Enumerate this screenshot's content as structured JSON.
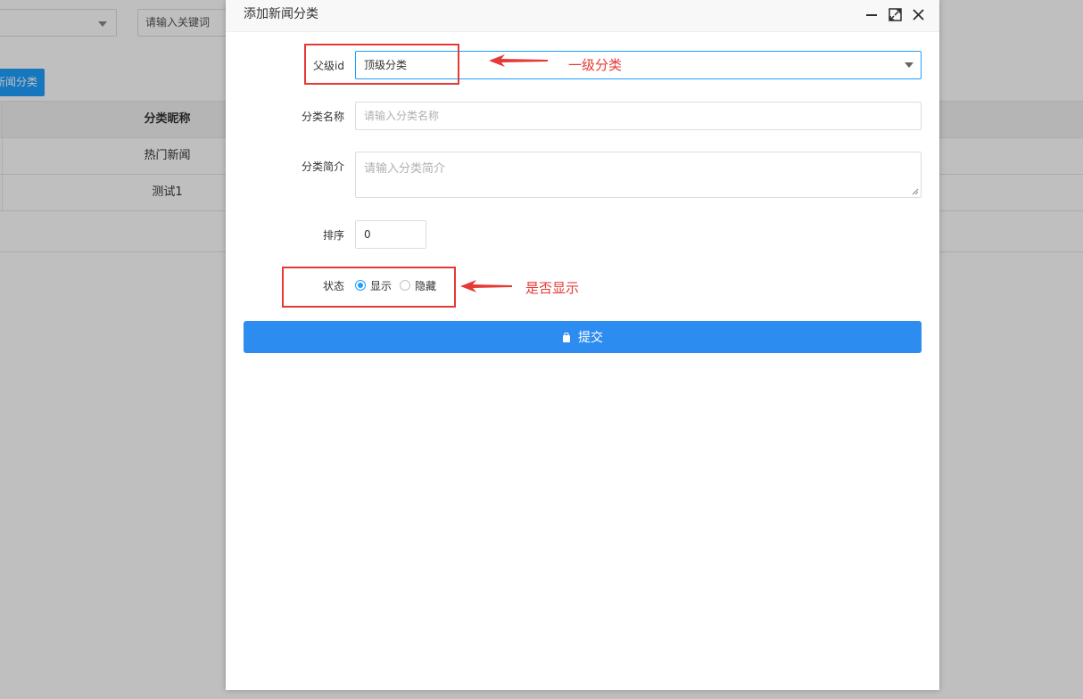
{
  "background": {
    "search_placeholder": "请输入关键词",
    "add_button_label": "新闻分类",
    "table": {
      "column_header": "分类昵称",
      "rows": [
        "热门新闻",
        "测试1"
      ]
    }
  },
  "modal": {
    "title": "添加新闻分类",
    "fields": {
      "parent_label": "父级id",
      "parent_value": "顶级分类",
      "name_label": "分类名称",
      "name_placeholder": "请输入分类名称",
      "desc_label": "分类简介",
      "desc_placeholder": "请输入分类简介",
      "sort_label": "排序",
      "sort_value": "0",
      "status_label": "状态",
      "status_options": [
        "显示",
        "隐藏"
      ],
      "status_selected": "显示"
    },
    "submit_label": "提交",
    "icons": [
      "minimize-icon",
      "maximize-icon",
      "close-icon",
      "shopping-bag-icon",
      "chevron-down-icon"
    ]
  },
  "annotations": {
    "parent_note": "一级分类",
    "status_note": "是否显示"
  },
  "colors": {
    "primary": "#2d8cf0",
    "accent_blue": "#1e9fff",
    "annotation_red": "#e53935"
  }
}
